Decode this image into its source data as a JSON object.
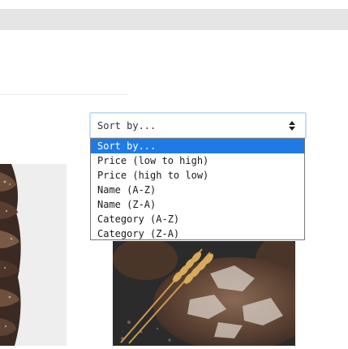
{
  "sort": {
    "selected_label": "Sort by...",
    "options": [
      "Sort by...",
      "Price (low to high)",
      "Price (high to low)",
      "Name (A-Z)",
      "Name (Z-A)",
      "Category (A-Z)",
      "Category (Z-A)"
    ],
    "selected_index": 0,
    "highlight_color": "#1e7be6",
    "focus_border_color": "#c9dff3",
    "arrow_icon": "sort-updown-icon"
  },
  "images": {
    "left": "sliced-bread-photo",
    "right": "rustic-bread-with-wheat-photo"
  },
  "colors": {
    "top_bar": "#e5e5e5"
  }
}
